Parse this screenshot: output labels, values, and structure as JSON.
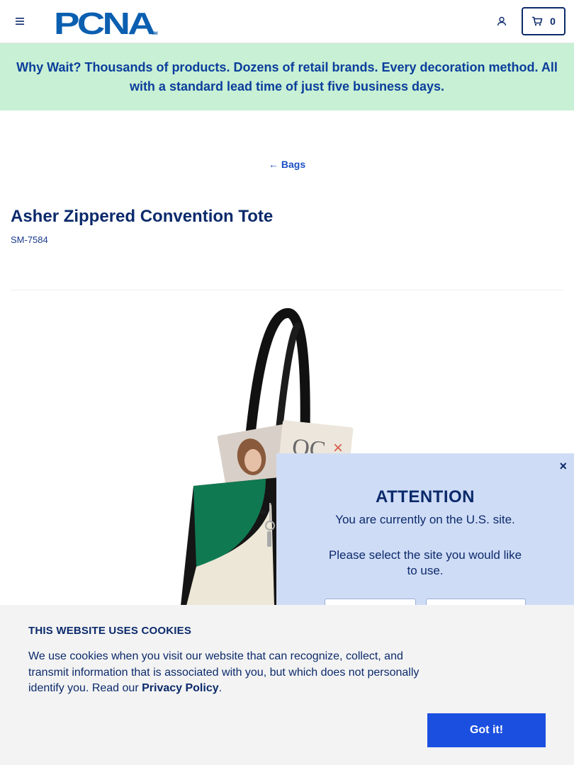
{
  "header": {
    "logo_text": "PCNA",
    "logo_tm": "TM",
    "cart_count": "0",
    "icons": {
      "menu": "hamburger-menu-icon",
      "account": "user-icon",
      "cart": "cart-icon"
    }
  },
  "promo": {
    "text": "Why Wait? Thousands of products. Dozens of retail brands. Every decoration method. All with a standard lead time of just five business days."
  },
  "breadcrumb": {
    "back_label": "Bags",
    "arrow": "←"
  },
  "product": {
    "title": "Asher Zippered Convention Tote",
    "sku": "SM-7584",
    "image_alt": "Asher Zippered Convention Tote"
  },
  "site_modal": {
    "close": "×",
    "title": "ATTENTION",
    "line1": "You are currently on the U.S. site.",
    "line2": "Please select the site you would like to use."
  },
  "cookie_banner": {
    "title": "THIS WEBSITE USES COOKIES",
    "text": "We use cookies when you visit our website that can recognize, collect, and transmit information that is associated with you, but which does not personally identify you. Read our ",
    "link": "Privacy Policy",
    "text_end": ".",
    "button": "Got it!"
  },
  "colors": {
    "brand_navy": "#0b2a6b",
    "brand_blue": "#1a4fc4",
    "promo_bg": "#c8f0d4",
    "modal_bg": "#cfdcf6",
    "cookie_bg": "#f3f3f3",
    "cookie_button": "#1b4fe0"
  }
}
